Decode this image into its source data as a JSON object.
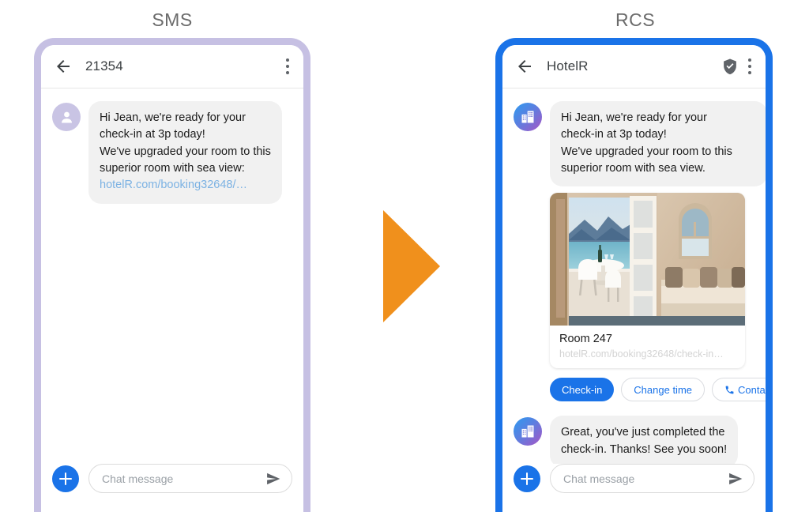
{
  "headings": {
    "sms": "SMS",
    "rcs": "RCS"
  },
  "colors": {
    "sms_frame": "#c6c0e3",
    "rcs_frame": "#1a73e8",
    "accent_blue": "#1a73e8",
    "arrow_orange": "#f0901c",
    "bubble_bg": "#f1f1f1",
    "sms_link": "#7cb2e3",
    "card_url": "#d3d3d3"
  },
  "sms_phone": {
    "appbar": {
      "back_icon": "arrow-left-icon",
      "title": "21354",
      "menu_icon": "overflow-menu-icon"
    },
    "avatar_icon": "person-avatar-icon",
    "message": {
      "lines": [
        "Hi Jean, we're ready for your",
        "check-in at 3p today!",
        "We've upgraded your room to this",
        "superior room with sea view:"
      ],
      "link": "hotelR.com/booking32648/…"
    },
    "composer": {
      "plus_icon": "plus-icon",
      "placeholder": "Chat message",
      "value": "",
      "send_icon": "send-icon"
    }
  },
  "rcs_phone": {
    "appbar": {
      "back_icon": "arrow-left-icon",
      "title": "HotelR",
      "verified_icon": "verified-shield-icon",
      "menu_icon": "overflow-menu-icon"
    },
    "avatar_icon": "business-building-icon",
    "message1": {
      "lines": [
        "Hi Jean, we're ready for your",
        "check-in at 3p today!",
        "We've upgraded your room to this",
        "superior room with sea view."
      ]
    },
    "card": {
      "image_alt": "hotel-room-sea-view-photo",
      "title": "Room 247",
      "url": "hotelR.com/booking32648/check-in…"
    },
    "actions": [
      {
        "label": "Check-in",
        "style": "filled",
        "icon": null
      },
      {
        "label": "Change time",
        "style": "outline",
        "icon": null
      },
      {
        "label": "Contact",
        "style": "outline",
        "icon": "phone-icon"
      }
    ],
    "message2": {
      "lines": [
        "Great, you've just completed the",
        "check-in. Thanks! See you soon!"
      ]
    },
    "composer": {
      "plus_icon": "plus-icon",
      "placeholder": "Chat message",
      "value": "",
      "send_icon": "send-icon"
    }
  }
}
